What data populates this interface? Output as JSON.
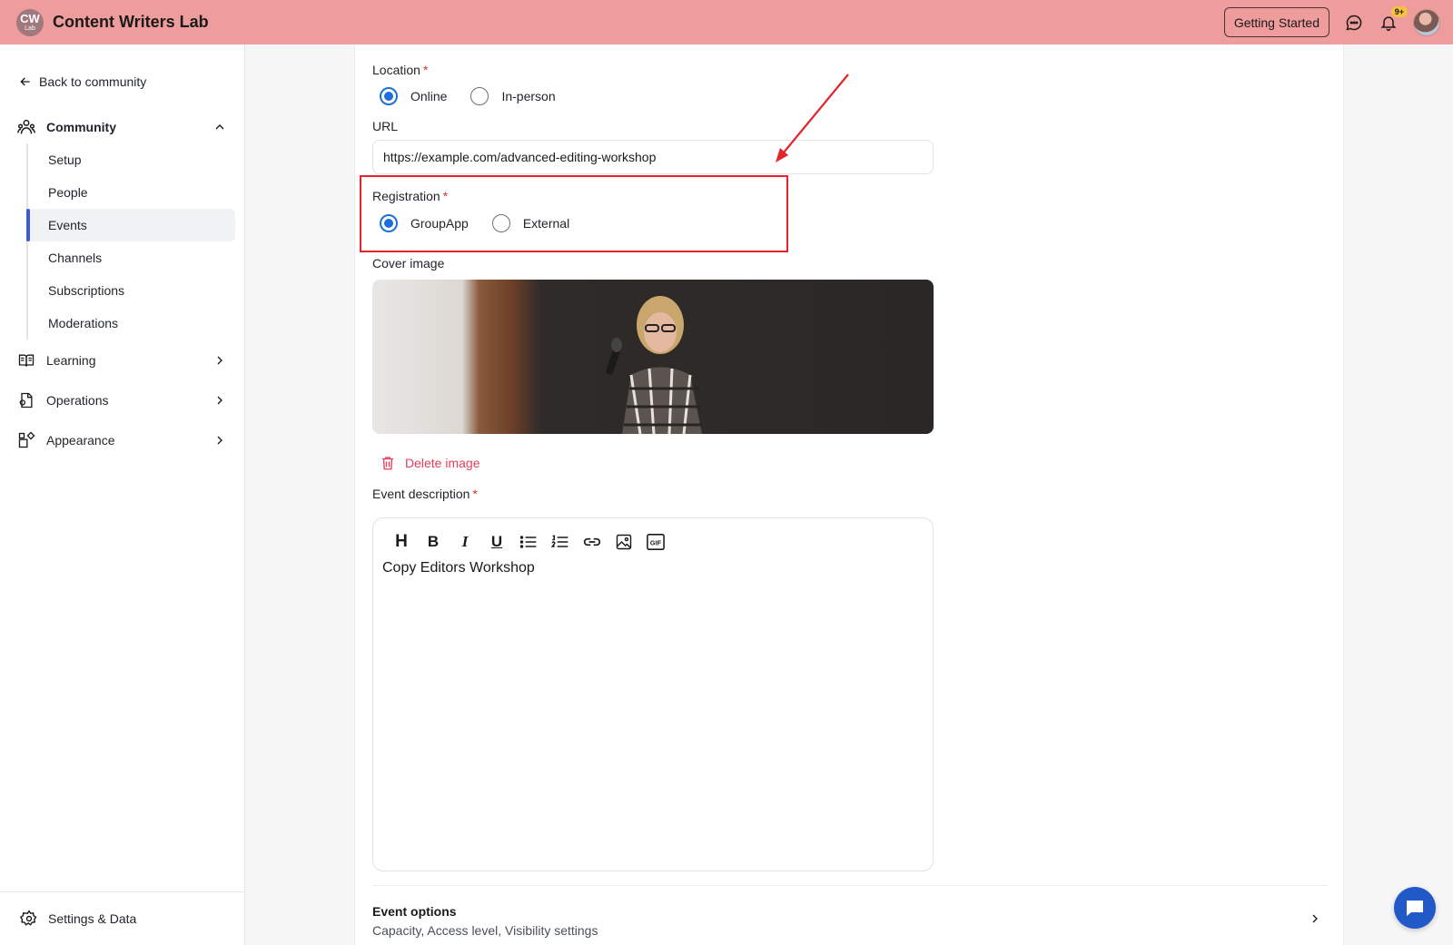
{
  "header": {
    "logo": {
      "line1": "CW",
      "line2": "Lab"
    },
    "brand": "Content Writers Lab",
    "getting_started": "Getting Started",
    "notification_badge": "9+"
  },
  "sidebar": {
    "back_label": "Back to community",
    "sections": [
      {
        "label": "Community",
        "icon": "community-icon",
        "expanded": true
      },
      {
        "label": "Learning",
        "icon": "book-icon",
        "expanded": false
      },
      {
        "label": "Operations",
        "icon": "operations-icon",
        "expanded": false
      },
      {
        "label": "Appearance",
        "icon": "appearance-icon",
        "expanded": false
      }
    ],
    "community_items": [
      "Setup",
      "People",
      "Events",
      "Channels",
      "Subscriptions",
      "Moderations"
    ],
    "active_item": "Events",
    "settings_label": "Settings & Data"
  },
  "form": {
    "location": {
      "label": "Location",
      "options": [
        "Online",
        "In-person"
      ],
      "selected": "Online"
    },
    "url": {
      "label": "URL",
      "value": "https://example.com/advanced-editing-workshop"
    },
    "registration": {
      "label": "Registration",
      "options": [
        "GroupApp",
        "External"
      ],
      "selected": "GroupApp"
    },
    "cover_image": {
      "label": "Cover image",
      "delete_label": "Delete image"
    },
    "description": {
      "label": "Event description",
      "toolbar": [
        "H",
        "B",
        "I",
        "U",
        "bulleted-list",
        "numbered-list",
        "link",
        "image",
        "GIF"
      ],
      "text": "Copy Editors Workshop"
    },
    "event_options": {
      "title": "Event options",
      "subtitle": "Capacity, Access level, Visibility settings"
    }
  },
  "colors": {
    "topbar": "#ee9c9c",
    "accent": "#1c6fd8",
    "highlight": "#e3242b",
    "danger": "#e0405a",
    "fab": "#2259c9"
  }
}
